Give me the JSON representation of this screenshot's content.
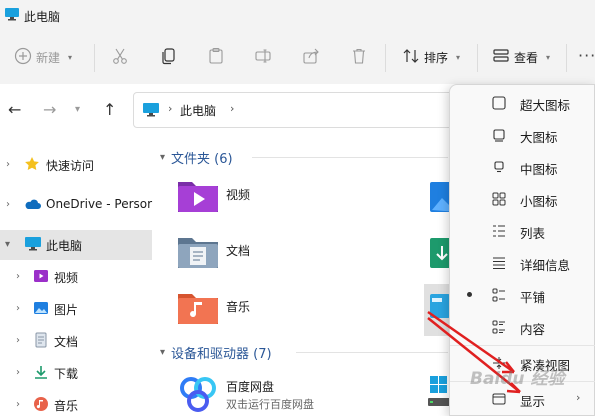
{
  "window": {
    "title": "此电脑"
  },
  "toolbar": {
    "new_label": "新建",
    "sort_label": "排序",
    "view_label": "查看",
    "more_label": "···"
  },
  "address": {
    "location": "此电脑"
  },
  "nav": {
    "items": [
      {
        "label": "快速访问",
        "icon": "star-icon"
      },
      {
        "label": "OneDrive - Persor",
        "icon": "cloud-icon"
      },
      {
        "label": "此电脑",
        "icon": "monitor-icon",
        "selected": true
      },
      {
        "label": "视频",
        "icon": "video-icon"
      },
      {
        "label": "图片",
        "icon": "picture-icon"
      },
      {
        "label": "文档",
        "icon": "document-icon"
      },
      {
        "label": "下载",
        "icon": "download-icon"
      },
      {
        "label": "音乐",
        "icon": "music-icon"
      }
    ]
  },
  "content": {
    "folders_header": "文件夹 (6)",
    "folders": [
      {
        "label": "视频"
      },
      {
        "label": "文档"
      },
      {
        "label": "音乐"
      }
    ],
    "devices_header": "设备和驱动器 (7)",
    "devices": [
      {
        "name": "百度网盘",
        "desc": "双击运行百度网盘"
      }
    ]
  },
  "view_menu": {
    "items": [
      {
        "label": "超大图标",
        "icon": "extra-large-icons-icon"
      },
      {
        "label": "大图标",
        "icon": "large-icons-icon"
      },
      {
        "label": "中图标",
        "icon": "medium-icons-icon"
      },
      {
        "label": "小图标",
        "icon": "small-icons-icon"
      },
      {
        "label": "列表",
        "icon": "list-icon"
      },
      {
        "label": "详细信息",
        "icon": "details-icon"
      },
      {
        "label": "平铺",
        "icon": "tiles-icon",
        "selected": true
      },
      {
        "label": "内容",
        "icon": "content-icon"
      },
      {
        "label": "紧凑视图",
        "icon": "compact-view-icon"
      },
      {
        "label": "显示",
        "icon": "show-icon",
        "submenu": true
      }
    ]
  },
  "watermark": "Baidu 经验",
  "colors": {
    "accent": "#0067c0",
    "arrow": "#e02020",
    "folder_header": "#2b5797"
  }
}
